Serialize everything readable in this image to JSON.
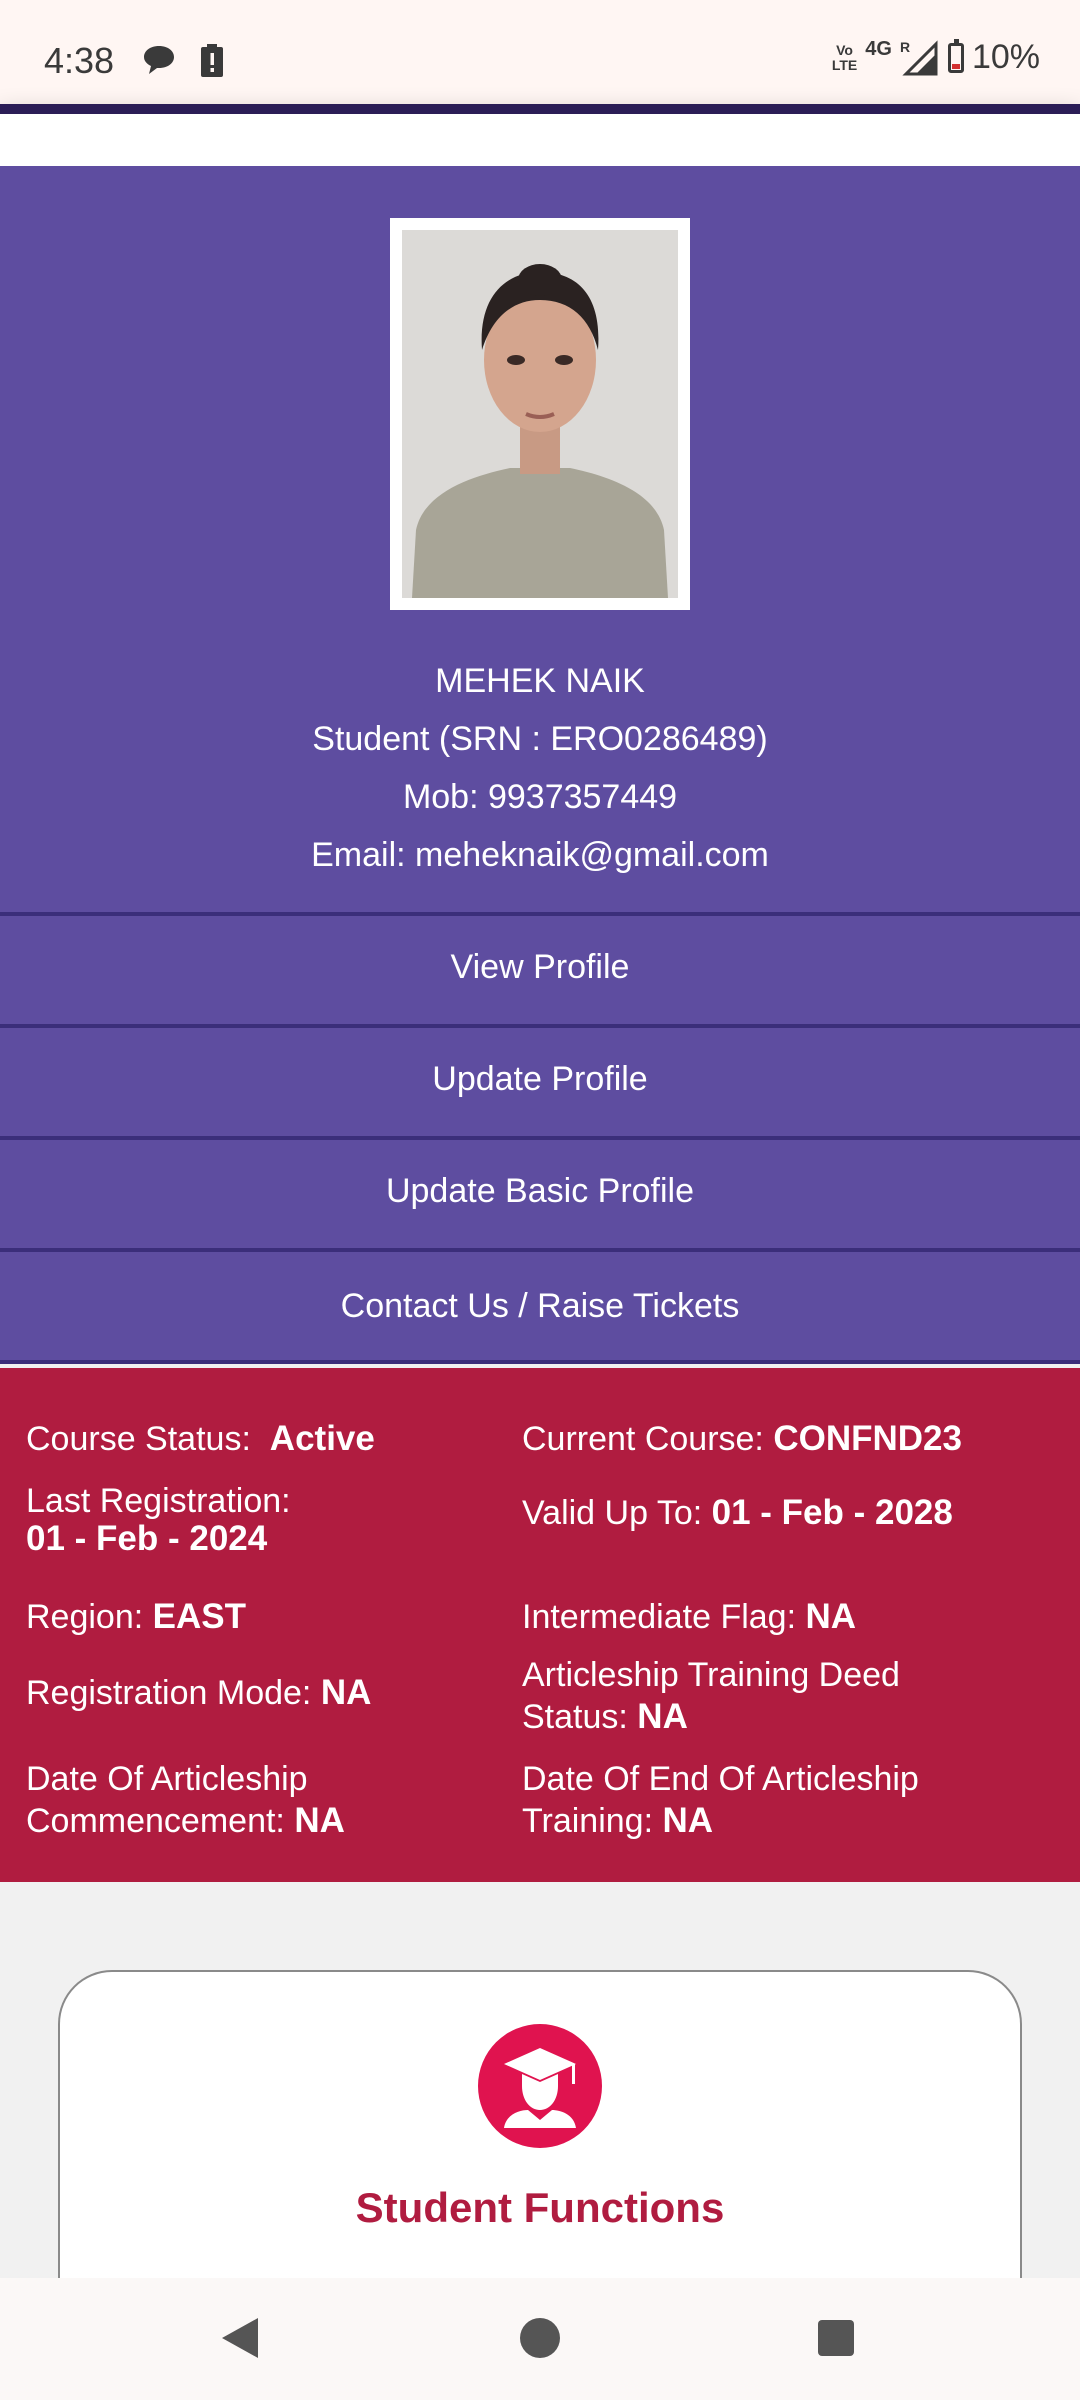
{
  "status_bar": {
    "time": "4:38",
    "volte_top": "Vo",
    "volte_bottom": "LTE",
    "network": "4G",
    "roaming": "R",
    "battery": "10%"
  },
  "profile": {
    "name": "MEHEK NAIK",
    "role_line": "Student (SRN : ERO0286489)",
    "mobile_line": "Mob: 9937357449",
    "email_line": "Email: meheknaik@gmail.com"
  },
  "menu": [
    {
      "label": "View Profile"
    },
    {
      "label": "Update Profile"
    },
    {
      "label": "Update Basic Profile"
    },
    {
      "label": "Contact Us / Raise Tickets"
    }
  ],
  "details": {
    "course_status": {
      "label": "Course Status:",
      "value": "Active"
    },
    "current_course": {
      "label": "Current Course:",
      "value": "CONFND23"
    },
    "last_registration": {
      "label": "Last Registration:",
      "value": "01 - Feb - 2024"
    },
    "valid_up_to": {
      "label": "Valid Up To:",
      "value": "01 - Feb - 2028"
    },
    "region": {
      "label": "Region:",
      "value": "EAST"
    },
    "intermediate_flag": {
      "label": "Intermediate Flag:",
      "value": "NA"
    },
    "registration_mode": {
      "label": "Registration Mode:",
      "value": "NA"
    },
    "deed_status": {
      "label_line1": "Articleship Training Deed",
      "label_line2": "Status:",
      "value": "NA"
    },
    "commencement": {
      "label_line1": "Date Of Articleship",
      "label_line2": "Commencement:",
      "value": "NA"
    },
    "end_date": {
      "label_line1": "Date Of End Of Articleship",
      "label_line2": "Training:",
      "value": "NA"
    }
  },
  "card": {
    "icon": "graduate-icon",
    "title": "Student Functions"
  },
  "nav": {
    "back_icon": "back-icon",
    "home_icon": "home-icon",
    "recents_icon": "recents-icon"
  },
  "colors": {
    "profile_bg": "#5e4da0",
    "details_bg": "#b01c40",
    "card_icon_bg": "#e0134f"
  }
}
